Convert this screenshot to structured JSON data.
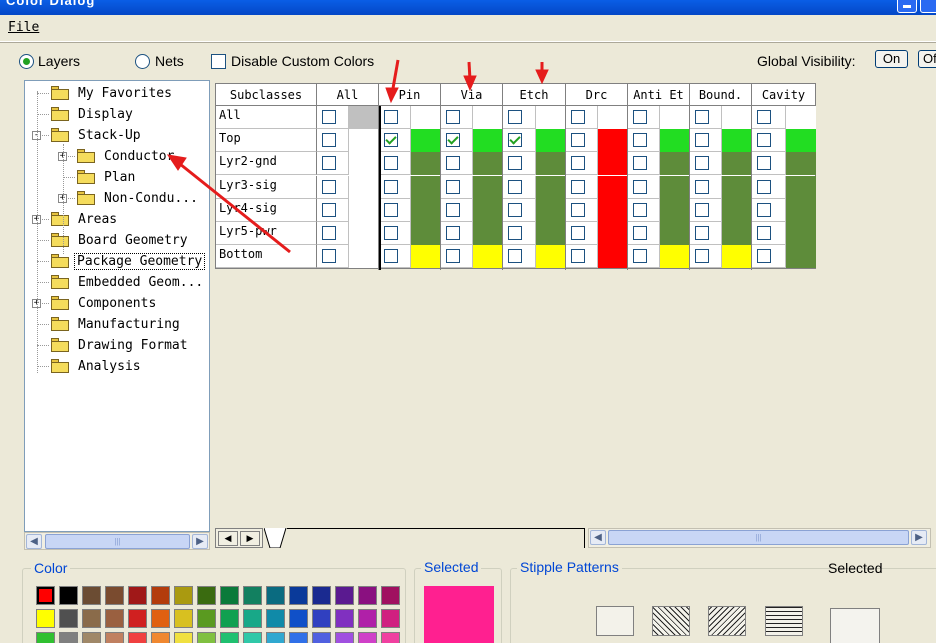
{
  "window": {
    "title": "Color Dialog"
  },
  "menu": {
    "file": "File"
  },
  "mode": {
    "layers": "Layers",
    "nets": "Nets",
    "disable_custom": "Disable Custom Colors",
    "selected": "layers"
  },
  "global_visibility": {
    "label": "Global Visibility:",
    "on": "On",
    "off": "Off"
  },
  "tree": [
    {
      "label": "My Favorites",
      "level": 0,
      "expander": ""
    },
    {
      "label": "Display",
      "level": 0,
      "expander": ""
    },
    {
      "label": "Stack-Up",
      "level": 0,
      "expander": "-"
    },
    {
      "label": "Conductor",
      "level": 1,
      "expander": "+"
    },
    {
      "label": "Plan",
      "level": 1,
      "expander": ""
    },
    {
      "label": "Non-Condu...",
      "level": 1,
      "expander": "+"
    },
    {
      "label": "Areas",
      "level": 0,
      "expander": "+"
    },
    {
      "label": "Board Geometry",
      "level": 0,
      "expander": ""
    },
    {
      "label": "Package Geometry",
      "level": 0,
      "expander": "",
      "focused": true
    },
    {
      "label": "Embedded Geom...",
      "level": 0,
      "expander": ""
    },
    {
      "label": "Components",
      "level": 0,
      "expander": "+"
    },
    {
      "label": "Manufacturing",
      "level": 0,
      "expander": ""
    },
    {
      "label": "Drawing Format",
      "level": 0,
      "expander": ""
    },
    {
      "label": "Analysis",
      "level": 0,
      "expander": ""
    }
  ],
  "grid": {
    "columns": [
      "Subclasses",
      "All",
      "Pin",
      "Via",
      "Etch",
      "Drc",
      "Anti Et",
      "Bound.",
      "Cavity"
    ],
    "rows": [
      {
        "name": "All",
        "checks": [
          false,
          false,
          false,
          false,
          false,
          false,
          false,
          false
        ],
        "colors": [
          "#c0c0c0",
          "#ffffff",
          "#ffffff",
          "#ffffff",
          "#ffffff",
          "#ffffff",
          "#ffffff",
          "#ffffff"
        ]
      },
      {
        "name": "Top",
        "checks": [
          false,
          true,
          true,
          true,
          false,
          false,
          false,
          false
        ],
        "colors": [
          "#ffffff",
          "#22dd22",
          "#22dd22",
          "#22dd22",
          "#ff0000",
          "#22dd22",
          "#22dd22",
          "#22dd22"
        ]
      },
      {
        "name": "Lyr2-gnd",
        "checks": [
          false,
          false,
          false,
          false,
          false,
          false,
          false,
          false
        ],
        "colors": [
          "#ffffff",
          "#5e8c3a",
          "#5e8c3a",
          "#5e8c3a",
          "#ff0000",
          "#5e8c3a",
          "#5e8c3a",
          "#5e8c3a"
        ]
      },
      {
        "name": "Lyr3-sig",
        "checks": [
          false,
          false,
          false,
          false,
          false,
          false,
          false,
          false
        ],
        "colors": [
          "#ffffff",
          "#5e8c3a",
          "#5e8c3a",
          "#5e8c3a",
          "#ff0000",
          "#5e8c3a",
          "#5e8c3a",
          "#5e8c3a"
        ]
      },
      {
        "name": "Lyr4-sig",
        "checks": [
          false,
          false,
          false,
          false,
          false,
          false,
          false,
          false
        ],
        "colors": [
          "#ffffff",
          "#5e8c3a",
          "#5e8c3a",
          "#5e8c3a",
          "#ff0000",
          "#5e8c3a",
          "#5e8c3a",
          "#5e8c3a"
        ]
      },
      {
        "name": "Lyr5-pwr",
        "checks": [
          false,
          false,
          false,
          false,
          false,
          false,
          false,
          false
        ],
        "colors": [
          "#ffffff",
          "#5e8c3a",
          "#5e8c3a",
          "#5e8c3a",
          "#ff0000",
          "#5e8c3a",
          "#5e8c3a",
          "#5e8c3a"
        ]
      },
      {
        "name": "Bottom",
        "checks": [
          false,
          false,
          false,
          false,
          false,
          false,
          false,
          false
        ],
        "colors": [
          "#ffffff",
          "#ffff00",
          "#ffff00",
          "#ffff00",
          "#ff0000",
          "#ffff00",
          "#ffff00",
          "#5e8c3a"
        ]
      }
    ]
  },
  "color_panel": {
    "title": "Color",
    "palette": [
      [
        "#ff0000",
        "#000000",
        "#6b4c33",
        "#7a4b2f",
        "#a01818",
        "#b33c0c",
        "#aa9a10",
        "#3a6b10",
        "#0a7a3a",
        "#128060",
        "#0a6b80",
        "#0a3a9a",
        "#1a2a90",
        "#5a1a90",
        "#8a1080",
        "#a01060"
      ],
      [
        "#ffff00",
        "#505050",
        "#8a6b4a",
        "#9a6040",
        "#d02020",
        "#e06010",
        "#d8c020",
        "#5a9a20",
        "#10a050",
        "#18a888",
        "#108aa8",
        "#1050c8",
        "#3040c0",
        "#8030c0",
        "#b020a8",
        "#d02080"
      ],
      [
        "#30c030",
        "#808080",
        "#a08868",
        "#c08060",
        "#f04040",
        "#f08830",
        "#f0e040",
        "#80c040",
        "#20c070",
        "#30c8a8",
        "#30a8d0",
        "#3070e8",
        "#5060e0",
        "#a050e0",
        "#d040c8",
        "#f040a0"
      ]
    ],
    "selected_title": "Selected",
    "selected_color": "#ff2090"
  },
  "stipple_panel": {
    "title": "Stipple Patterns",
    "selected_title": "Selected"
  }
}
